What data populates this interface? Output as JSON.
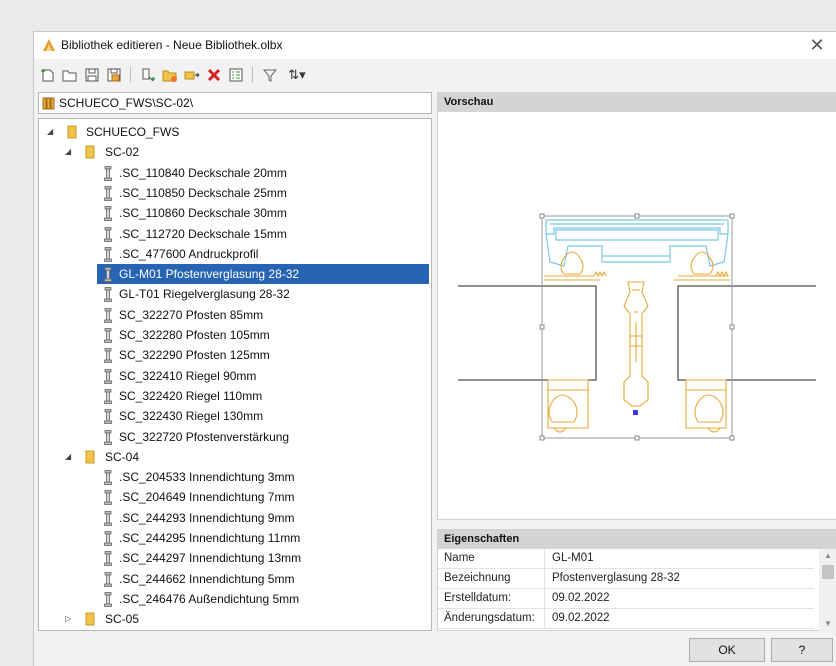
{
  "window": {
    "title": "Bibliothek editieren - Neue Bibliothek.olbx",
    "close_glyph": "✕",
    "app_icon": "app-triangle-icon"
  },
  "toolbar": {
    "items": [
      "new-icon",
      "open-folder-icon",
      "save-icon",
      "save-as-icon",
      "add-profile-icon",
      "add-folder-icon",
      "rename-icon",
      "delete-icon",
      "properties-icon",
      "filter-icon",
      "sort-icon"
    ],
    "sort_label": "⇅▾"
  },
  "path": {
    "value": "SCHUECO_FWS\\SC-02\\"
  },
  "tree": {
    "root": {
      "label": "SCHUECO_FWS",
      "expanded": true
    },
    "groups": [
      {
        "label": "SC-02",
        "expanded": true,
        "items": [
          ".SC_110840 Deckschale 20mm",
          ".SC_110850 Deckschale 25mm",
          ".SC_110860 Deckschale 30mm",
          ".SC_112720 Deckschale 15mm",
          ".SC_477600 Andruckprofil",
          "GL-M01 Pfostenverglasung 28-32",
          "GL-T01 Riegelverglasung 28-32",
          "SC_322270 Pfosten 85mm",
          "SC_322280 Pfosten 105mm",
          "SC_322290 Pfosten 125mm",
          "SC_322410 Riegel 90mm",
          "SC_322420 Riegel 110mm",
          "SC_322430 Riegel 130mm",
          "SC_322720 Pfostenverstärkung"
        ]
      },
      {
        "label": "SC-04",
        "expanded": true,
        "items": [
          ".SC_204533 Innendichtung 3mm",
          ".SC_204649 Innendichtung 7mm",
          ".SC_244293 Innendichtung 9mm",
          ".SC_244295 Innendichtung 11mm",
          ".SC_244297 Innendichtung 13mm",
          ".SC_244662 Innendichtung 5mm",
          ".SC_246476 Außendichtung 5mm"
        ]
      },
      {
        "label": "SC-05",
        "expanded": false,
        "items": []
      }
    ],
    "selected": "GL-M01 Pfostenverglasung 28-32"
  },
  "preview": {
    "header": "Vorschau"
  },
  "properties": {
    "header": "Eigenschaften",
    "rows": [
      {
        "name": "Name",
        "value": "GL-M01"
      },
      {
        "name": "Bezeichnung",
        "value": "Pfostenverglasung 28-32"
      },
      {
        "name": "Erstelldatum:",
        "value": "09.02.2022"
      },
      {
        "name": "Änderungsdatum:",
        "value": "09.02.2022"
      }
    ]
  },
  "buttons": {
    "ok": "OK",
    "help": "?"
  },
  "colors": {
    "selection": "#2864b4",
    "profile_orange": "#e8a93a",
    "profile_blue": "#7cc8e4",
    "folder": "#f2c34a"
  }
}
